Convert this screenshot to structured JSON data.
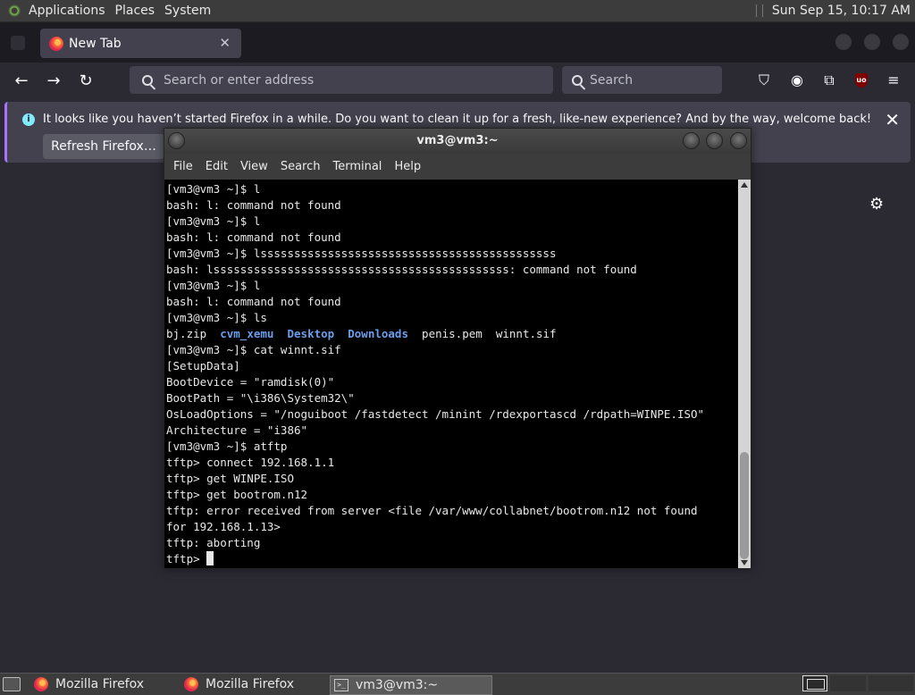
{
  "top_panel": {
    "menus": [
      "Applications",
      "Places",
      "System"
    ],
    "clock": "Sun Sep 15, 10:17 AM"
  },
  "browser": {
    "tab_title": "New Tab",
    "url_placeholder": "Search or enter address",
    "search_placeholder": "Search",
    "notification": {
      "message": "It looks like you haven’t started Firefox in a while. Do you want to clean it up for a fresh, like-new experience? And by the way, welcome back!",
      "button": "Refresh Firefox…"
    }
  },
  "terminal": {
    "title": "vm3@vm3:~",
    "menu": [
      "File",
      "Edit",
      "View",
      "Search",
      "Terminal",
      "Help"
    ],
    "lines": [
      "[vm3@vm3 ~]$ l",
      "bash: l: command not found",
      "[vm3@vm3 ~]$ l",
      "bash: l: command not found",
      "[vm3@vm3 ~]$ lssssssssssssssssssssssssssssssssssssssssssss",
      "bash: lssssssssssssssssssssssssssssssssssssssssssss: command not found",
      "[vm3@vm3 ~]$ l",
      "bash: l: command not found",
      "[vm3@vm3 ~]$ ls",
      "__LS__",
      "[vm3@vm3 ~]$ cat winnt.sif",
      "[SetupData]",
      "BootDevice = \"ramdisk(0)\"",
      "BootPath = \"\\i386\\System32\\\"",
      "OsLoadOptions = \"/noguiboot /fastdetect /minint /rdexportascd /rdpath=WINPE.ISO\"",
      "Architecture = \"i386\"",
      "[vm3@vm3 ~]$ atftp",
      "tftp> connect 192.168.1.1",
      "tftp> get WINPE.ISO",
      "tftp> get bootrom.n12",
      "tftp: error received from server <file /var/www/collabnet/bootrom.n12 not found",
      "for 192.168.1.13>",
      "tftp: aborting"
    ],
    "ls_output": [
      {
        "name": "bj.zip",
        "dir": false
      },
      {
        "name": "cvm_xemu",
        "dir": true
      },
      {
        "name": "Desktop",
        "dir": true
      },
      {
        "name": "Downloads",
        "dir": true
      },
      {
        "name": "penis.pem",
        "dir": false
      },
      {
        "name": "winnt.sif",
        "dir": false
      }
    ],
    "prompt": "tftp> "
  },
  "taskbar": {
    "items": [
      "Mozilla Firefox",
      "Mozilla Firefox",
      "vm3@vm3:~"
    ]
  },
  "colors": {
    "directory": "#6d9eeb",
    "accent": "#ab71ff"
  }
}
